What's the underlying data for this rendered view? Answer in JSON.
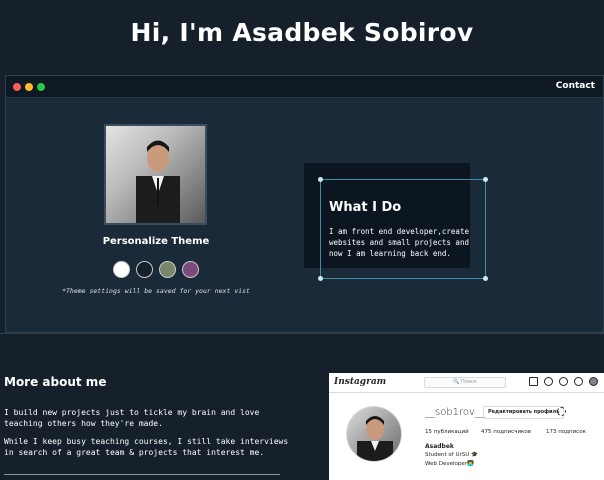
{
  "header": {
    "greeting": "Hi, I'm Asadbek Sobirov"
  },
  "browser": {
    "nav": {
      "contact_label": "Contact"
    },
    "theme": {
      "title": "Personalize Theme",
      "note": "*Theme settings will be saved for your next vist",
      "swatches": [
        {
          "name": "light",
          "color": "#ffffff"
        },
        {
          "name": "dark",
          "color": "#15202b"
        },
        {
          "name": "green",
          "color": "#78866b"
        },
        {
          "name": "purple",
          "color": "#7b4a7b"
        }
      ]
    },
    "what_i_do": {
      "title": "What I Do",
      "text": "I am front end developer,create websites and small projects and now I am learning back end."
    }
  },
  "more_about": {
    "title": "More about me",
    "paragraphs": [
      "I build new projects just to tickle my brain and love teaching others how they're made.",
      "While I keep busy teaching courses, I still take interviews in search of a great team & projects that interest me."
    ]
  },
  "instagram": {
    "logo": "Instagram",
    "search_placeholder": "🔍 Поиск",
    "username": "__sob1rov__",
    "edit_label": "Редактировать профиль",
    "stats": [
      "15 публикаций",
      "475 подписчиков",
      "173 подписок"
    ],
    "name": "Asadbek",
    "bio_line1": "Student of UrSU 🎓",
    "bio_line2": "Web Developer👨‍💻"
  },
  "colors": {
    "background": "#15202b",
    "accent": "#3e8fa4",
    "card": "#1a2a38"
  }
}
